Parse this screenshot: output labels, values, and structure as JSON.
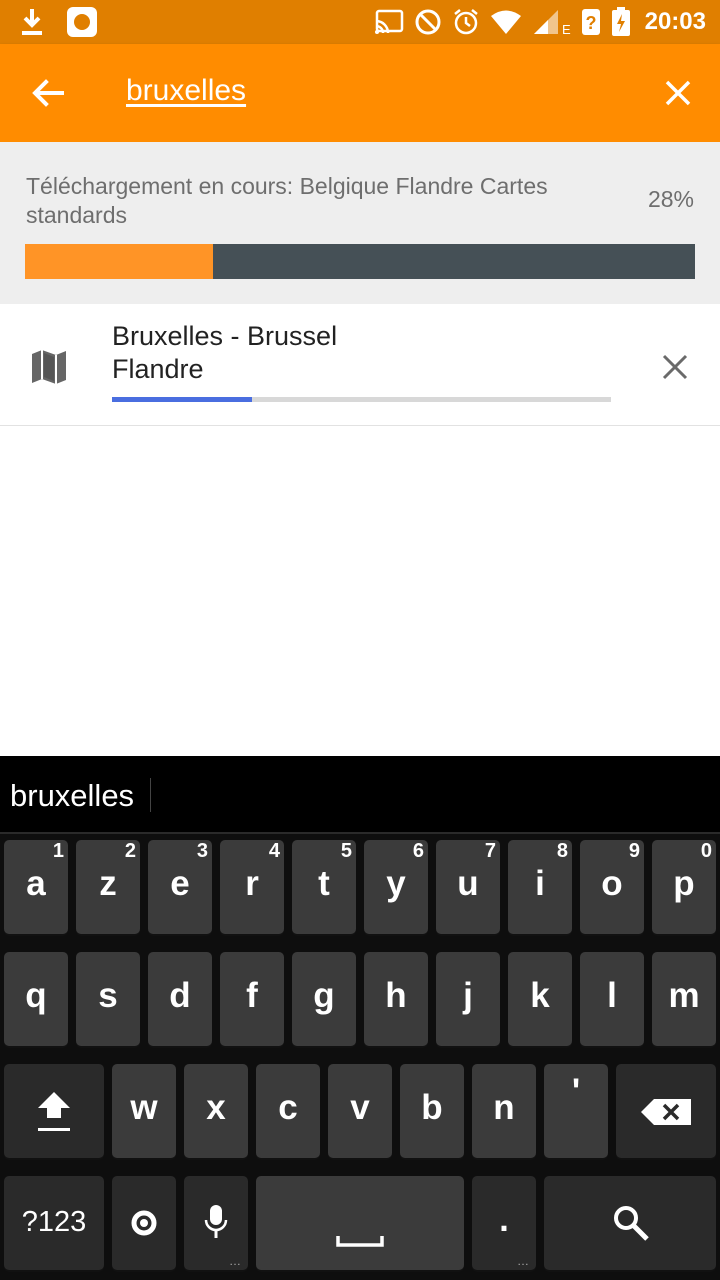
{
  "status_bar": {
    "time": "20:03",
    "icons": [
      "download-icon",
      "notification-app-icon",
      "cast-icon",
      "do-not-disturb-icon",
      "alarm-icon",
      "wifi-icon",
      "signal-icon",
      "unknown-sim-icon",
      "battery-charging-icon"
    ],
    "network_label": "E"
  },
  "app_bar": {
    "search_query": "bruxelles",
    "back_icon": "arrow-left-icon",
    "clear_icon": "close-icon",
    "background_color": "#ff8c00"
  },
  "download_banner": {
    "text": "Téléchargement en cours: Belgique Flandre Cartes standards",
    "percent_label": "28%",
    "progress": 0.28,
    "fill_color": "#ff9426",
    "track_color": "#455056"
  },
  "results": [
    {
      "icon": "map-icon",
      "title": "Bruxelles - Brussel",
      "subtitle": "Flandre",
      "progress": 0.28,
      "cancel_icon": "close-icon"
    }
  ],
  "keyboard": {
    "suggestion": "bruxelles",
    "row1": [
      {
        "ch": "a",
        "hint": "1"
      },
      {
        "ch": "z",
        "hint": "2"
      },
      {
        "ch": "e",
        "hint": "3"
      },
      {
        "ch": "r",
        "hint": "4"
      },
      {
        "ch": "t",
        "hint": "5"
      },
      {
        "ch": "y",
        "hint": "6"
      },
      {
        "ch": "u",
        "hint": "7"
      },
      {
        "ch": "i",
        "hint": "8"
      },
      {
        "ch": "o",
        "hint": "9"
      },
      {
        "ch": "p",
        "hint": "0"
      }
    ],
    "row2": [
      "q",
      "s",
      "d",
      "f",
      "g",
      "h",
      "j",
      "k",
      "l",
      "m"
    ],
    "row3": [
      "w",
      "x",
      "c",
      "v",
      "b",
      "n",
      "'"
    ],
    "symbols_label": "?123",
    "period_label": ".",
    "shift_icon": "shift-icon",
    "backspace_icon": "backspace-icon",
    "settings_icon": "keyboard-settings-icon",
    "mic_icon": "microphone-icon",
    "space_icon": "space-bar-icon",
    "search_icon": "search-icon"
  }
}
